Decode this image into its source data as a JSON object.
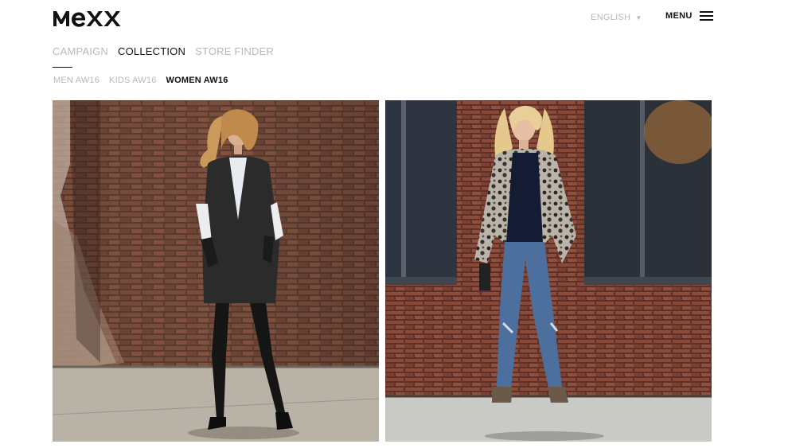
{
  "brand": {
    "logo_text": "MEXX"
  },
  "header": {
    "language": {
      "selected": "ENGLISH",
      "caret_icon": "caret-down-icon"
    },
    "menu": {
      "label": "MENU",
      "icon": "hamburger-icon"
    }
  },
  "primary_nav": {
    "items": [
      {
        "label": "CAMPAIGN",
        "active": false
      },
      {
        "label": "COLLECTION",
        "active": true
      },
      {
        "label": "STORE FINDER",
        "active": false
      }
    ]
  },
  "sub_nav": {
    "items": [
      {
        "label": "MEN AW16",
        "active": false
      },
      {
        "label": "KIDS AW16",
        "active": false
      },
      {
        "label": "WOMEN AW16",
        "active": true
      }
    ]
  },
  "gallery": {
    "images": [
      {
        "subject": "woman in black wool coat against brick wall"
      },
      {
        "subject": "woman in leopard jacket and ripped jeans on street"
      }
    ]
  },
  "colors": {
    "active": "#111111",
    "inactive": "#b8b8b8",
    "background": "#ffffff"
  }
}
